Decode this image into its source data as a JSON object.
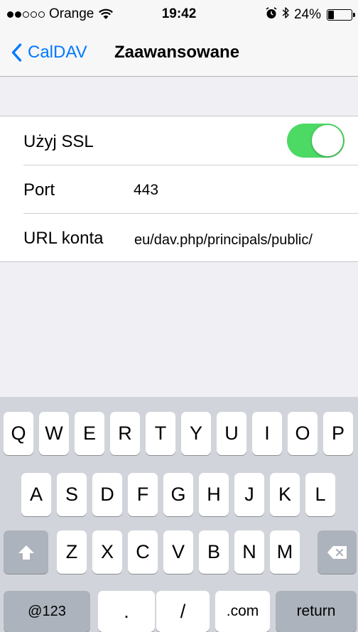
{
  "status_bar": {
    "signal_filled": 2,
    "signal_total": 5,
    "carrier": "Orange",
    "time": "19:42",
    "battery_percent": "24%",
    "battery_level": 0.24,
    "icons": [
      "wifi-icon",
      "alarm-icon",
      "bluetooth-icon",
      "battery-icon"
    ]
  },
  "nav": {
    "back_label": "CalDAV",
    "title": "Zaawansowane",
    "accent_color": "#0079ff"
  },
  "settings": {
    "use_ssl": {
      "label": "Użyj SSL",
      "on": true,
      "on_color": "#4cd964"
    },
    "port": {
      "label": "Port",
      "value": "443"
    },
    "account_url": {
      "label": "URL konta",
      "value": "eu/dav.php/principals/public/"
    }
  },
  "keyboard": {
    "row1": [
      "Q",
      "W",
      "E",
      "R",
      "T",
      "Y",
      "U",
      "I",
      "O",
      "P"
    ],
    "row2": [
      "A",
      "S",
      "D",
      "F",
      "G",
      "H",
      "J",
      "K",
      "L"
    ],
    "row3": [
      "Z",
      "X",
      "C",
      "V",
      "B",
      "N",
      "M"
    ],
    "shift_icon": "shift-icon",
    "delete_icon": "delete-icon",
    "numbers_label": "@123",
    "period_label": ".",
    "slash_label": "/",
    "dotcom_label": ".com",
    "return_label": "return"
  }
}
